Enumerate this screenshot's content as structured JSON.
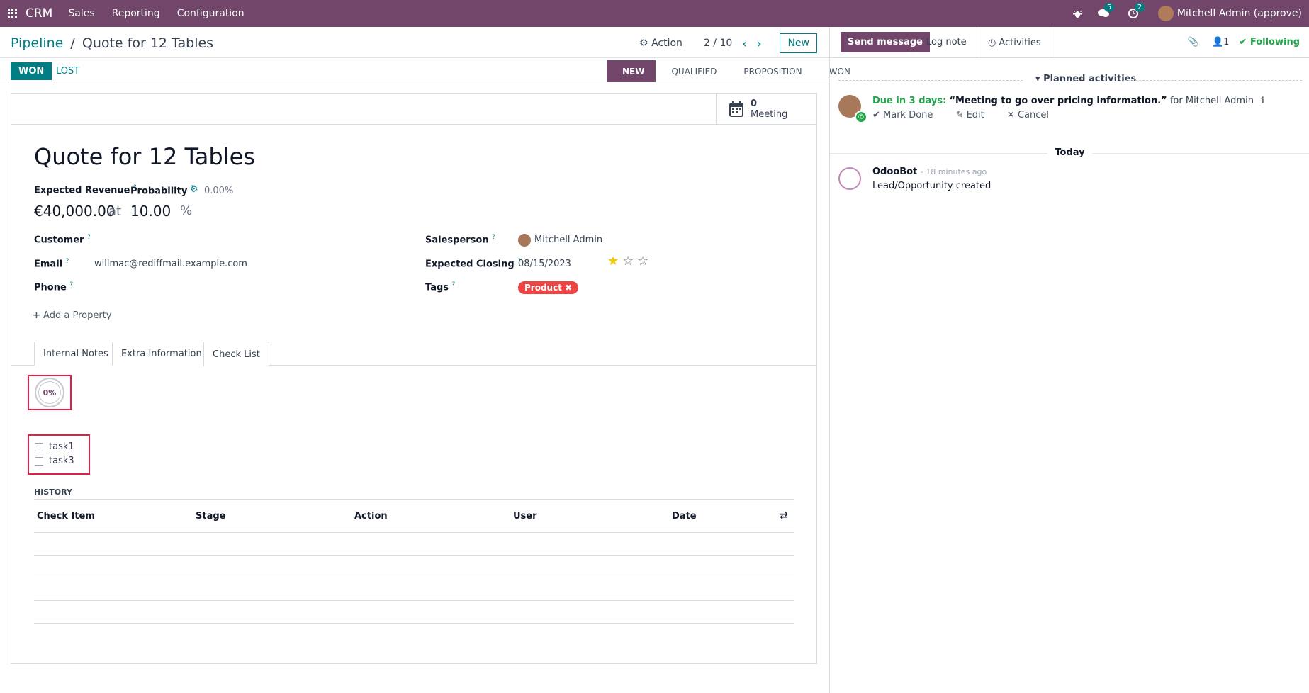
{
  "topbar": {
    "app_name": "CRM",
    "menus": [
      "Sales",
      "Reporting",
      "Configuration"
    ],
    "messages_count": "5",
    "activities_count": "2",
    "user": "Mitchell Admin (approve)"
  },
  "control": {
    "breadcrumb_parent": "Pipeline",
    "breadcrumb_sep": "/",
    "breadcrumb_current": "Quote for 12 Tables",
    "action_label": "Action",
    "pager": "2 / 10",
    "new_label": "New"
  },
  "status": {
    "won_label": "WON",
    "lost_label": "LOST",
    "stages": [
      "NEW",
      "QUALIFIED",
      "PROPOSITION",
      "WON"
    ],
    "active_stage": "NEW"
  },
  "smart_button": {
    "count": "0",
    "label": "Meeting"
  },
  "record": {
    "title": "Quote for 12 Tables",
    "expected_revenue_label": "Expected Revenue",
    "probability_label": "Probability",
    "auto_probability": "0.00%",
    "revenue": "€40,000.00",
    "at_label": "at",
    "probability": "10.00",
    "percent_sign": "%",
    "customer_label": "Customer",
    "email_label": "Email",
    "email": "willmac@rediffmail.example.com",
    "phone_label": "Phone",
    "salesperson_label": "Salesperson",
    "salesperson": "Mitchell Admin",
    "expected_closing_label": "Expected Closing",
    "expected_closing": "08/15/2023",
    "priority_stars": 1,
    "tags_label": "Tags",
    "tag": "Product",
    "add_property": "Add a Property"
  },
  "tabs": [
    "Internal Notes",
    "Extra Information",
    "Check List"
  ],
  "active_tab": "Check List",
  "checklist": {
    "progress": "0%",
    "items": [
      "task1",
      "task3"
    ]
  },
  "history": {
    "title": "HISTORY",
    "columns": [
      "Check Item",
      "Stage",
      "Action",
      "User",
      "Date"
    ]
  },
  "chatter": {
    "send_message": "Send message",
    "log_note": "Log note",
    "activities": "Activities",
    "followers_count": "1",
    "following": "Following",
    "planned_label": "Planned activities",
    "activity": {
      "due": "Due in 3 days:",
      "summary": "“Meeting to go over pricing information.”",
      "for": "for Mitchell Admin",
      "mark_done": "Mark Done",
      "edit": "Edit",
      "cancel": "Cancel"
    },
    "today_label": "Today",
    "message": {
      "author": "OdooBot",
      "time": "- 18 minutes ago",
      "body": "Lead/Opportunity created"
    }
  },
  "colors": {
    "brand": "#71466a",
    "accent": "#017e84",
    "success": "#22a64a",
    "tag": "#ef4444"
  }
}
